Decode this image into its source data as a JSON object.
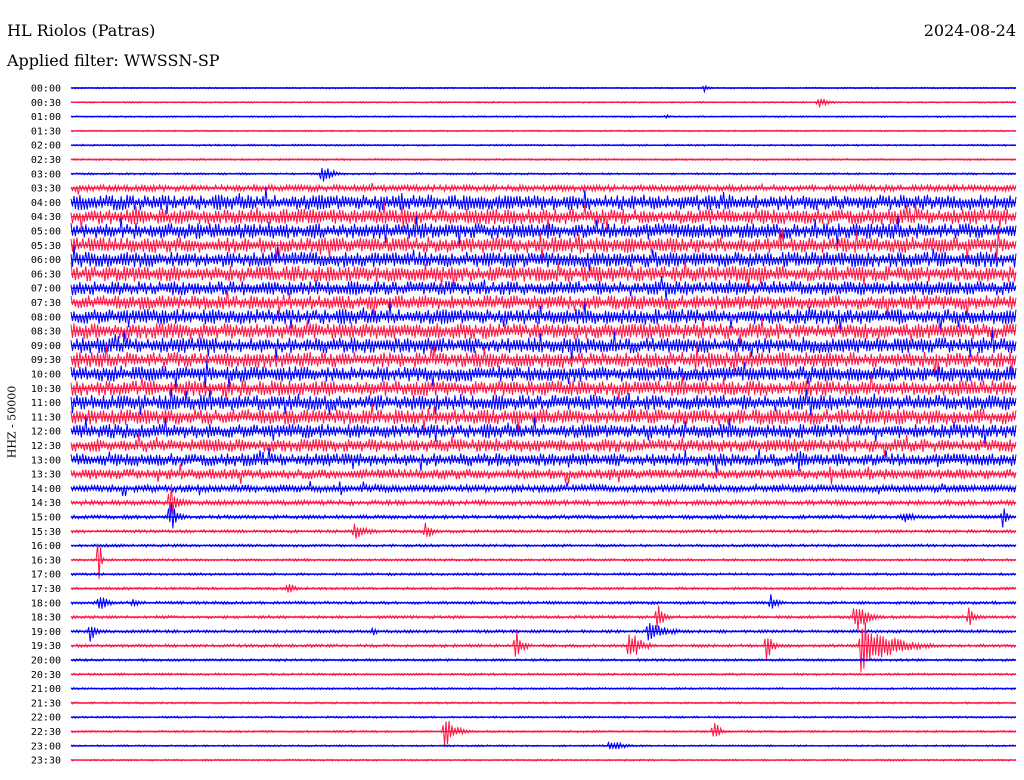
{
  "header": {
    "station": "HL Riolos (Patras)",
    "date": "2024-08-24",
    "filter": "Applied filter: WWSSN-SP"
  },
  "colors": {
    "blue": "#0000ff",
    "red": "#ff1744"
  },
  "chart_data": {
    "type": "line",
    "title": "HL Riolos (Patras)",
    "date": "2024-08-24",
    "filter": "WWSSN-SP",
    "ylabel": "HHZ - 50000",
    "rows": [
      {
        "time": "00:00",
        "color": "blue",
        "noise": 0.6
      },
      {
        "time": "00:30",
        "color": "red",
        "noise": 0.6
      },
      {
        "time": "01:00",
        "color": "blue",
        "noise": 0.6
      },
      {
        "time": "01:30",
        "color": "red",
        "noise": 0.6
      },
      {
        "time": "02:00",
        "color": "blue",
        "noise": 0.7
      },
      {
        "time": "02:30",
        "color": "red",
        "noise": 0.7
      },
      {
        "time": "03:00",
        "color": "blue",
        "noise": 0.8
      },
      {
        "time": "03:30",
        "color": "red",
        "noise": 2.5
      },
      {
        "time": "04:00",
        "color": "blue",
        "noise": 6
      },
      {
        "time": "04:30",
        "color": "red",
        "noise": 6
      },
      {
        "time": "05:00",
        "color": "blue",
        "noise": 6
      },
      {
        "time": "05:30",
        "color": "red",
        "noise": 6
      },
      {
        "time": "06:00",
        "color": "blue",
        "noise": 6
      },
      {
        "time": "06:30",
        "color": "red",
        "noise": 6
      },
      {
        "time": "07:00",
        "color": "blue",
        "noise": 5.5
      },
      {
        "time": "07:30",
        "color": "red",
        "noise": 5.5
      },
      {
        "time": "08:00",
        "color": "blue",
        "noise": 6
      },
      {
        "time": "08:30",
        "color": "red",
        "noise": 6
      },
      {
        "time": "09:00",
        "color": "blue",
        "noise": 6
      },
      {
        "time": "09:30",
        "color": "red",
        "noise": 6
      },
      {
        "time": "10:00",
        "color": "blue",
        "noise": 6
      },
      {
        "time": "10:30",
        "color": "red",
        "noise": 6
      },
      {
        "time": "11:00",
        "color": "blue",
        "noise": 6
      },
      {
        "time": "11:30",
        "color": "red",
        "noise": 6
      },
      {
        "time": "12:00",
        "color": "blue",
        "noise": 5.5
      },
      {
        "time": "12:30",
        "color": "red",
        "noise": 5
      },
      {
        "time": "13:00",
        "color": "blue",
        "noise": 5
      },
      {
        "time": "13:30",
        "color": "red",
        "noise": 4
      },
      {
        "time": "14:00",
        "color": "blue",
        "noise": 3
      },
      {
        "time": "14:30",
        "color": "red",
        "noise": 2
      },
      {
        "time": "15:00",
        "color": "blue",
        "noise": 1.5
      },
      {
        "time": "15:30",
        "color": "red",
        "noise": 1.2
      },
      {
        "time": "16:00",
        "color": "blue",
        "noise": 1.1
      },
      {
        "time": "16:30",
        "color": "red",
        "noise": 1
      },
      {
        "time": "17:00",
        "color": "blue",
        "noise": 1
      },
      {
        "time": "17:30",
        "color": "red",
        "noise": 1
      },
      {
        "time": "18:00",
        "color": "blue",
        "noise": 1.2
      },
      {
        "time": "18:30",
        "color": "red",
        "noise": 1.2
      },
      {
        "time": "19:00",
        "color": "blue",
        "noise": 1.2
      },
      {
        "time": "19:30",
        "color": "red",
        "noise": 1.2
      },
      {
        "time": "20:00",
        "color": "blue",
        "noise": 1
      },
      {
        "time": "20:30",
        "color": "red",
        "noise": 0.9
      },
      {
        "time": "21:00",
        "color": "blue",
        "noise": 0.8
      },
      {
        "time": "21:30",
        "color": "red",
        "noise": 0.8
      },
      {
        "time": "22:00",
        "color": "blue",
        "noise": 0.8
      },
      {
        "time": "22:30",
        "color": "red",
        "noise": 0.8
      },
      {
        "time": "23:00",
        "color": "blue",
        "noise": 0.7
      },
      {
        "time": "23:30",
        "color": "red",
        "noise": 0.7
      }
    ],
    "events": [
      {
        "row": 0,
        "at": 0.67,
        "amp": 4,
        "dur": 0.012
      },
      {
        "row": 1,
        "at": 0.79,
        "amp": 6,
        "dur": 0.03
      },
      {
        "row": 2,
        "at": 0.63,
        "amp": 3,
        "dur": 0.01
      },
      {
        "row": 6,
        "at": 0.265,
        "amp": 10,
        "dur": 0.03
      },
      {
        "row": 8,
        "at": 0.35,
        "amp": 10,
        "dur": 0.03
      },
      {
        "row": 9,
        "at": 0.35,
        "amp": 12,
        "dur": 0.03
      },
      {
        "row": 21,
        "at": 0.385,
        "amp": 10,
        "dur": 0.01
      },
      {
        "row": 22,
        "at": 0.385,
        "amp": 14,
        "dur": 0.01
      },
      {
        "row": 26,
        "at": 0.77,
        "amp": 16,
        "dur": 0.02
      },
      {
        "row": 29,
        "at": 0.105,
        "amp": 22,
        "dur": 0.02
      },
      {
        "row": 30,
        "at": 0.105,
        "amp": 16,
        "dur": 0.02
      },
      {
        "row": 30,
        "at": 0.985,
        "amp": 14,
        "dur": 0.015
      },
      {
        "row": 30,
        "at": 0.88,
        "amp": 6,
        "dur": 0.04
      },
      {
        "row": 31,
        "at": 0.3,
        "amp": 8,
        "dur": 0.04
      },
      {
        "row": 31,
        "at": 0.375,
        "amp": 10,
        "dur": 0.02
      },
      {
        "row": 33,
        "at": 0.03,
        "amp": 40,
        "dur": 0.005
      },
      {
        "row": 35,
        "at": 0.23,
        "amp": 8,
        "dur": 0.015
      },
      {
        "row": 36,
        "at": 0.03,
        "amp": 12,
        "dur": 0.02
      },
      {
        "row": 36,
        "at": 0.065,
        "amp": 6,
        "dur": 0.02
      },
      {
        "row": 36,
        "at": 0.74,
        "amp": 10,
        "dur": 0.02
      },
      {
        "row": 37,
        "at": 0.62,
        "amp": 14,
        "dur": 0.02
      },
      {
        "row": 37,
        "at": 0.83,
        "amp": 18,
        "dur": 0.03
      },
      {
        "row": 37,
        "at": 0.95,
        "amp": 10,
        "dur": 0.02
      },
      {
        "row": 38,
        "at": 0.02,
        "amp": 10,
        "dur": 0.02
      },
      {
        "row": 38,
        "at": 0.61,
        "amp": 12,
        "dur": 0.05
      },
      {
        "row": 38,
        "at": 0.32,
        "amp": 6,
        "dur": 0.01
      },
      {
        "row": 39,
        "at": 0.47,
        "amp": 18,
        "dur": 0.02
      },
      {
        "row": 39,
        "at": 0.59,
        "amp": 20,
        "dur": 0.03
      },
      {
        "row": 39,
        "at": 0.735,
        "amp": 16,
        "dur": 0.02
      },
      {
        "row": 39,
        "at": 0.835,
        "amp": 28,
        "dur": 0.08
      },
      {
        "row": 45,
        "at": 0.395,
        "amp": 16,
        "dur": 0.03
      },
      {
        "row": 45,
        "at": 0.68,
        "amp": 14,
        "dur": 0.015
      },
      {
        "row": 46,
        "at": 0.57,
        "amp": 6,
        "dur": 0.04
      }
    ]
  }
}
